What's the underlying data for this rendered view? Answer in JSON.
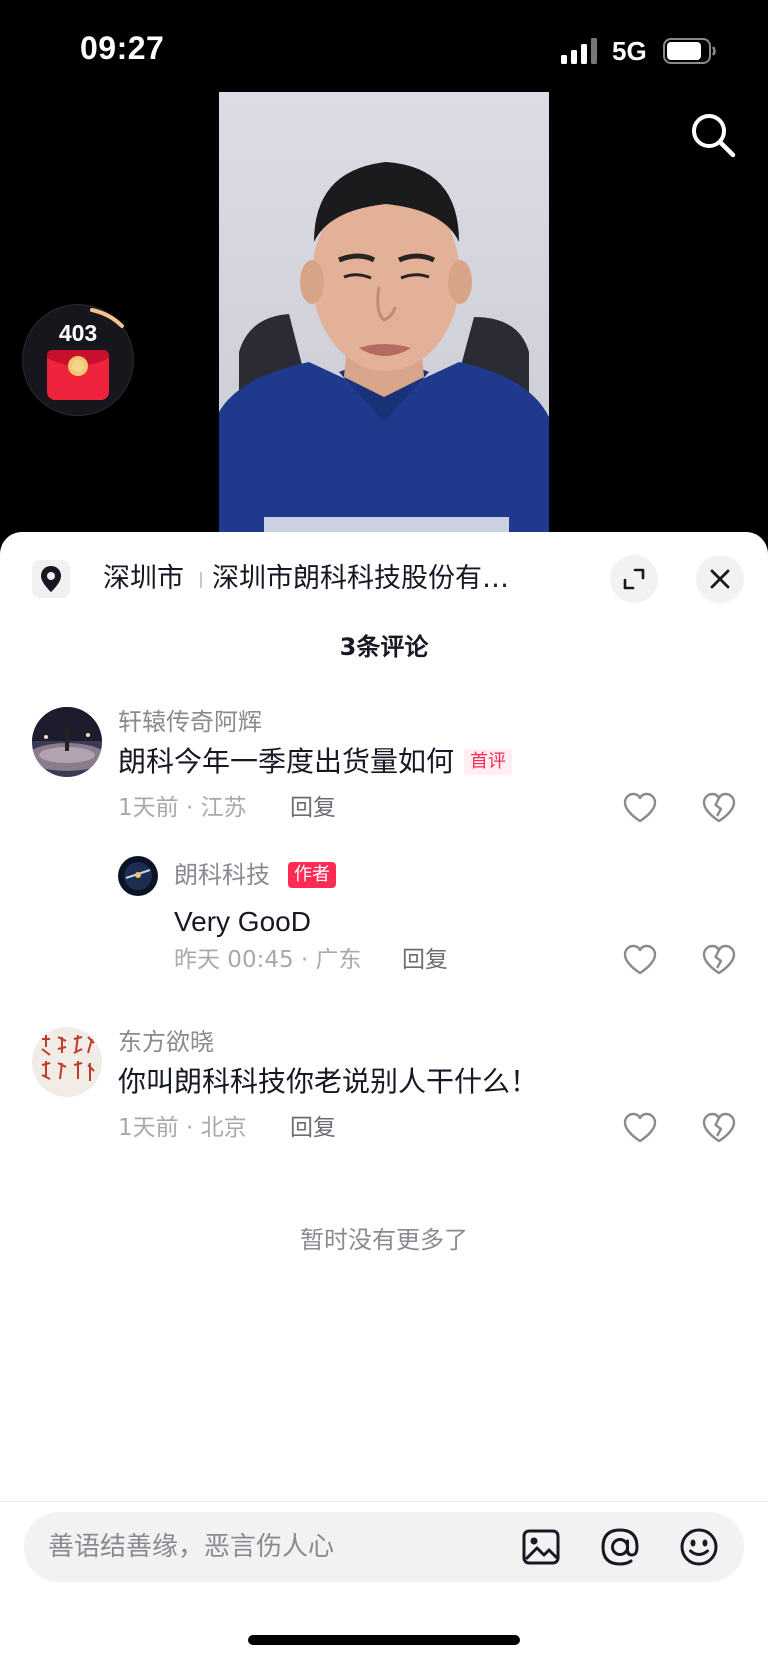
{
  "status_bar": {
    "time": "09:27",
    "network": "5G",
    "icons": [
      "signal-icon",
      "battery-icon"
    ]
  },
  "video": {
    "red_packet_count": "403",
    "icons": [
      "search-icon",
      "red-envelope-icon"
    ]
  },
  "location_bar": {
    "city": "深圳市",
    "company": "深圳市朗科科技股份有…",
    "icons": [
      "location-pin-icon",
      "expand-icon",
      "close-icon"
    ]
  },
  "comments_header": {
    "count_label": "3条评论"
  },
  "comments": [
    {
      "username": "轩辕传奇阿辉",
      "text": "朗科今年一季度出货量如何",
      "badge": "首评",
      "meta": "1天前 · 江苏",
      "reply_label": "回复",
      "replies": [
        {
          "username": "朗科科技",
          "badge": "作者",
          "text": "Very GooD",
          "meta": "昨天 00:45 · 广东",
          "reply_label": "回复"
        }
      ]
    },
    {
      "username": "东方欲晓",
      "text": "你叫朗科科技你老说别人干什么！",
      "meta": "1天前 · 北京",
      "reply_label": "回复",
      "replies": []
    }
  ],
  "list_end_text": "暂时没有更多了",
  "input_bar": {
    "placeholder": "善语结善缘，恶言伤人心",
    "icons": [
      "image-icon",
      "at-icon",
      "emoji-icon"
    ]
  },
  "colors": {
    "accent": "#fe2c55",
    "sheet_bg": "#ffffff",
    "muted_text": "#8a8b91"
  }
}
